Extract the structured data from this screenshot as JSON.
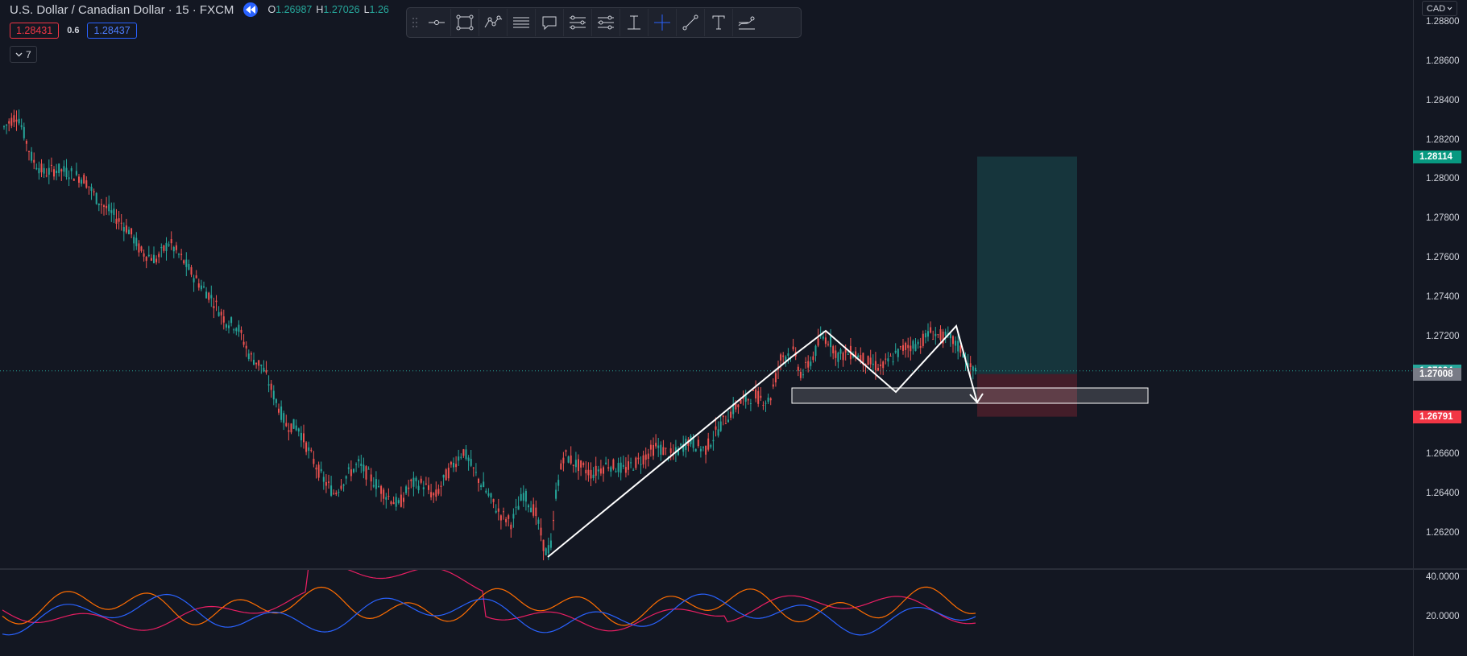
{
  "header": {
    "symbol_title": "U.S. Dollar / Canadian Dollar · 15 · FXCM",
    "ohlc": [
      {
        "key": "O",
        "value": "1.26987"
      },
      {
        "key": "H",
        "value": "1.27026"
      },
      {
        "key": "L",
        "value": "1.26"
      }
    ],
    "sell_price": "1.28431",
    "spread": "0.6",
    "buy_price": "1.28437",
    "indicators_count": "7",
    "collapse_icon": "chevron-down-icon",
    "replay_icon": "rewind-icon"
  },
  "toolbar": {
    "icons": [
      "drag-handle-icon",
      "horizontal-line-icon",
      "rectangle-icon",
      "path-icon",
      "parallel-lines-icon",
      "callout-icon",
      "price-range-icon",
      "date-range-icon",
      "measure-icon",
      "crosshair-icon",
      "trend-line-icon",
      "text-icon",
      "brush-icon"
    ]
  },
  "price_axis": {
    "currency": "CAD",
    "ticks": [
      "1.28800",
      "1.28600",
      "1.28400",
      "1.28200",
      "1.28000",
      "1.27800",
      "1.27600",
      "1.27400",
      "1.27200",
      "1.26600",
      "1.26400",
      "1.26200"
    ],
    "tick_values": [
      1.288,
      1.286,
      1.284,
      1.282,
      1.28,
      1.278,
      1.276,
      1.274,
      1.272,
      1.266,
      1.264,
      1.262
    ],
    "take_profit_label": "1.28114",
    "take_profit": 1.28114,
    "current_price_label": "1.27024",
    "current_price": 1.27024,
    "entry_label": "1.27008",
    "entry": 1.27008,
    "stop_loss_label": "1.26791",
    "stop_loss": 1.26791
  },
  "indicator_axis": {
    "ticks": [
      "40.0000",
      "20.0000"
    ],
    "tick_values": [
      40,
      20
    ]
  },
  "colors": {
    "background": "#131722",
    "up_candle": "#26a69a",
    "down_candle": "#ef5350",
    "profit_zone": "#26a69a",
    "loss_zone": "#f23645",
    "accent": "#2962ff",
    "adx_line": "#e91e63",
    "di_plus_line": "#ff6d00",
    "di_minus_line": "#2962ff"
  }
}
